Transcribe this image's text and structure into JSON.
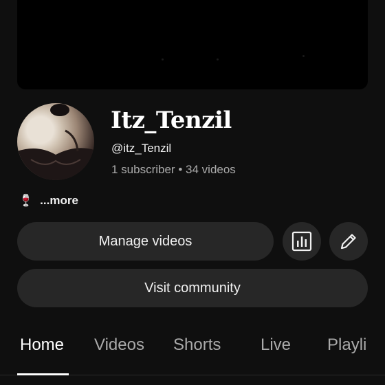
{
  "channel": {
    "name": "Itz_Tenzil",
    "handle": "@itz_Tenzil",
    "subscribers": "1 subscriber",
    "separator": "•",
    "videos": "34 videos"
  },
  "description": {
    "emoji": "🍷",
    "more_label": "...more"
  },
  "buttons": {
    "manage_videos": "Manage videos",
    "visit_community": "Visit community",
    "analytics_icon": "bar-chart-icon",
    "edit_icon": "pencil-icon"
  },
  "tabs": [
    {
      "label": "Home",
      "active": true
    },
    {
      "label": "Videos",
      "active": false
    },
    {
      "label": "Shorts",
      "active": false
    },
    {
      "label": "Live",
      "active": false
    },
    {
      "label": "Playli",
      "active": false
    }
  ],
  "colors": {
    "background": "#0f0f0f",
    "button": "#272727",
    "text_secondary": "#aaaaaa"
  }
}
